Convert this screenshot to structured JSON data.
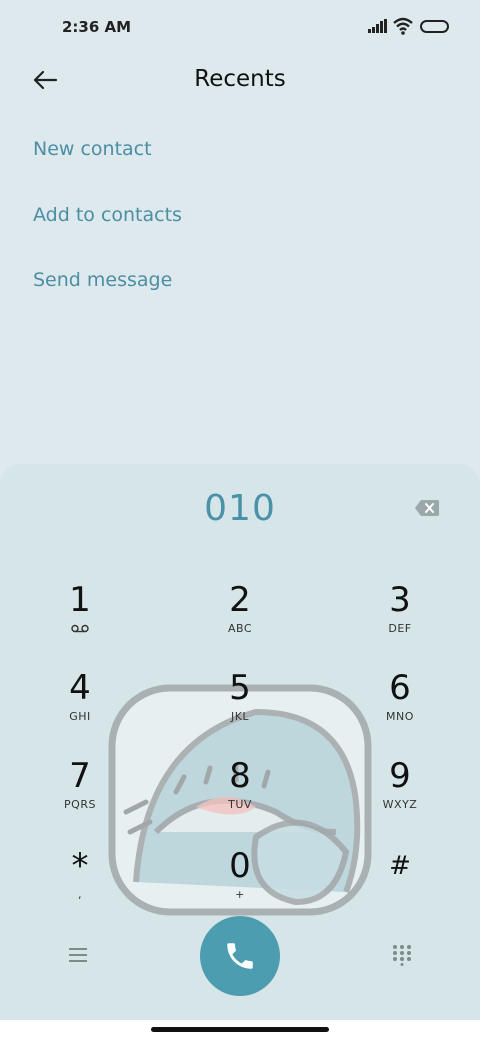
{
  "status_bar": {
    "time": "2:36 AM",
    "icons": [
      "signal-icon",
      "wifi-icon",
      "battery-icon"
    ]
  },
  "header": {
    "title": "Recents",
    "back_icon": "arrow-left-icon"
  },
  "menu": [
    {
      "label": "New contact"
    },
    {
      "label": "Add to contacts"
    },
    {
      "label": "Send message"
    }
  ],
  "dialer": {
    "number": "010",
    "backspace_icon": "backspace-icon",
    "keys": [
      {
        "digit": "1",
        "letters": ""
      },
      {
        "digit": "2",
        "letters": "ABC"
      },
      {
        "digit": "3",
        "letters": "DEF"
      },
      {
        "digit": "4",
        "letters": "GHI"
      },
      {
        "digit": "5",
        "letters": "JKL"
      },
      {
        "digit": "6",
        "letters": "MNO"
      },
      {
        "digit": "7",
        "letters": "PQRS"
      },
      {
        "digit": "8",
        "letters": "TUV"
      },
      {
        "digit": "9",
        "letters": "WXYZ"
      },
      {
        "digit": "*",
        "letters": ","
      },
      {
        "digit": "0",
        "letters": "+"
      },
      {
        "digit": "#",
        "letters": ""
      }
    ],
    "voicemail_icon": "voicemail-icon",
    "bottom": {
      "menu_icon": "menu-icon",
      "call_icon": "phone-icon",
      "keypad_icon": "dialpad-icon"
    }
  },
  "colors": {
    "accent": "#4a92a9",
    "call_button": "#4d9db0",
    "background": "#dbe8ec"
  }
}
